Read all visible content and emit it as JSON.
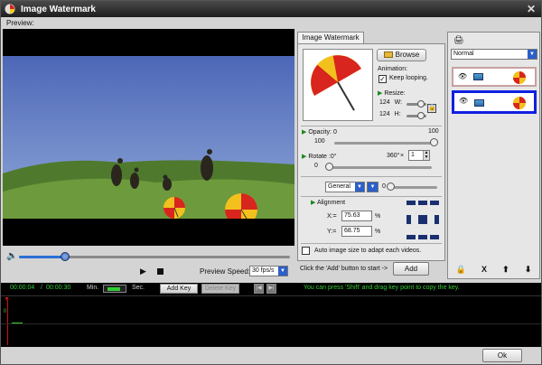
{
  "window": {
    "title": "Image Watermark",
    "close_icon": "close-icon"
  },
  "preview": {
    "label": "Preview:"
  },
  "player": {
    "progress": 0.17,
    "preview_speed_label": "Preview Speed:",
    "preview_speed_value": "30 fps/s"
  },
  "watermark": {
    "tab_label": "Image Watermark",
    "browse_label": "Browse",
    "animation_label": "Animation:",
    "keep_looping_label": "Keep looping.",
    "keep_looping_checked": true,
    "resize_label": "Resize:",
    "width_value": "124",
    "width_label": "W:",
    "height_value": "124",
    "height_label": "H:",
    "opacity_label": "Opacity:",
    "opacity_min": "0",
    "opacity_max": "100",
    "opacity_value": "100",
    "rotate_label": "Rotate :",
    "rotate_min": "0°",
    "rotate_max": "360°",
    "rotate_multiplier": "×",
    "rotate_count": "1",
    "rotate_value": "0",
    "mode_value": "General",
    "mode_sub_value": "0",
    "alignment_label": "Alignment",
    "x_label": "X:=",
    "x_value": "75.63",
    "x_unit": "%",
    "y_label": "Y:=",
    "y_value": "68.75",
    "y_unit": "%",
    "auto_size_label": "Auto image size to adapt each videos.",
    "click_hint": "Click the 'Add' button to start ->",
    "add_label": "Add"
  },
  "layers": {
    "blend_mode": "Normal",
    "items": [
      {
        "visible_icon": "eye-icon",
        "selected": false
      },
      {
        "visible_icon": "eye-icon",
        "selected": true
      }
    ]
  },
  "timeline": {
    "current_time": "00:00:04",
    "separator": "/",
    "total_time": "00:00:30",
    "min_label": "Min.",
    "sec_label": "Sec.",
    "add_key_label": "Add Key",
    "delete_key_label": "Delete Key",
    "prev_label": "|◀",
    "next_label": "▶|",
    "hint": "You can press 'Shift' and drag key point to copy the key.",
    "zero_label": "0"
  },
  "footer": {
    "ok_label": "Ok"
  },
  "colors": {
    "accent": "#2b5fc9",
    "timeline_text": "#33cc33",
    "selected_layer": "#1020e0"
  }
}
